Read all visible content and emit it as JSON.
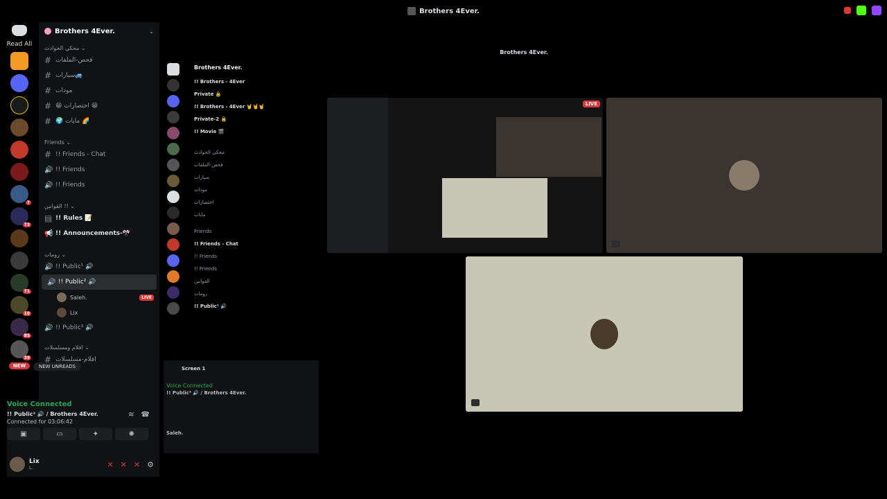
{
  "window": {
    "title": "Brothers 4Ever."
  },
  "rail": {
    "read_all": "Read All",
    "new_label": "NEW",
    "badges": [
      "7",
      "73",
      "71",
      "10",
      "85",
      "39"
    ]
  },
  "server": {
    "name": "Brothers 4Ever.",
    "categories": {
      "cat1": "محكي الحوادث",
      "friends": "Friends",
      "laws": "القوانين !!",
      "rooms": "رومات",
      "cat5": "افلام ومسلسلات"
    },
    "text_channels": [
      {
        "label": "فحص-الملفات"
      },
      {
        "label": "سيارات🚙"
      },
      {
        "label": "مودات"
      },
      {
        "label": "😁 اختصارات 😁"
      },
      {
        "label": "🌍 مايات 🌈"
      }
    ],
    "friends_channels": [
      {
        "label": "!! Friends - Chat"
      },
      {
        "label": "!! Friends"
      },
      {
        "label": "!! Friends"
      }
    ],
    "laws_channels": [
      {
        "label": "!! Rules 📝"
      },
      {
        "label": "!! Announcements-🎌"
      }
    ],
    "rooms_channels": [
      {
        "label": "!! Public¹ 🔊"
      },
      {
        "label": "!! Public² 🔊"
      },
      {
        "label": "!! Public³ 🔊"
      }
    ],
    "voice_users": [
      {
        "name": "Saleh.",
        "live": "LIVE"
      },
      {
        "name": "Lix"
      }
    ],
    "cat5_channels": [
      {
        "label": "افلام-مسلسلات"
      }
    ],
    "new_unreads": "NEW UNREADS"
  },
  "voice": {
    "status": "Voice Connected",
    "channel": "!! Public² 🔊 / Brothers 4Ever.",
    "connected_for": "Connected for 03:06:42"
  },
  "user": {
    "name": "Lix",
    "tag": "L."
  },
  "nested": {
    "title": "Brothers 4Ever.",
    "server_name": "Brothers 4Ever.",
    "channels": [
      "!! Brothers - 4Ever",
      "Private 🔒",
      "!! Brothers - 4Ever 🤘🤘🤘",
      "Private-2 🔒",
      "!! Movie 🎬",
      "محكي الحوادث",
      "فحص-الملفات",
      "سيارات",
      "مودات",
      "اختصارات",
      "مايات",
      "Friends",
      "!! Friends - Chat",
      "!! Friends",
      "!! Friends",
      "القوانين",
      "رومات",
      "!! Public¹ 🔊"
    ],
    "screen_label": "Screen 1",
    "voice_status": "Voice Connected",
    "voice_channel": "!! Public² 🔊 / Brothers 4Ever.",
    "user_name": "Saleh."
  },
  "stream": {
    "live_badge": "LIVE"
  },
  "colors": {
    "green": "#23a55a",
    "red": "#da373c",
    "bg": "#111214"
  }
}
